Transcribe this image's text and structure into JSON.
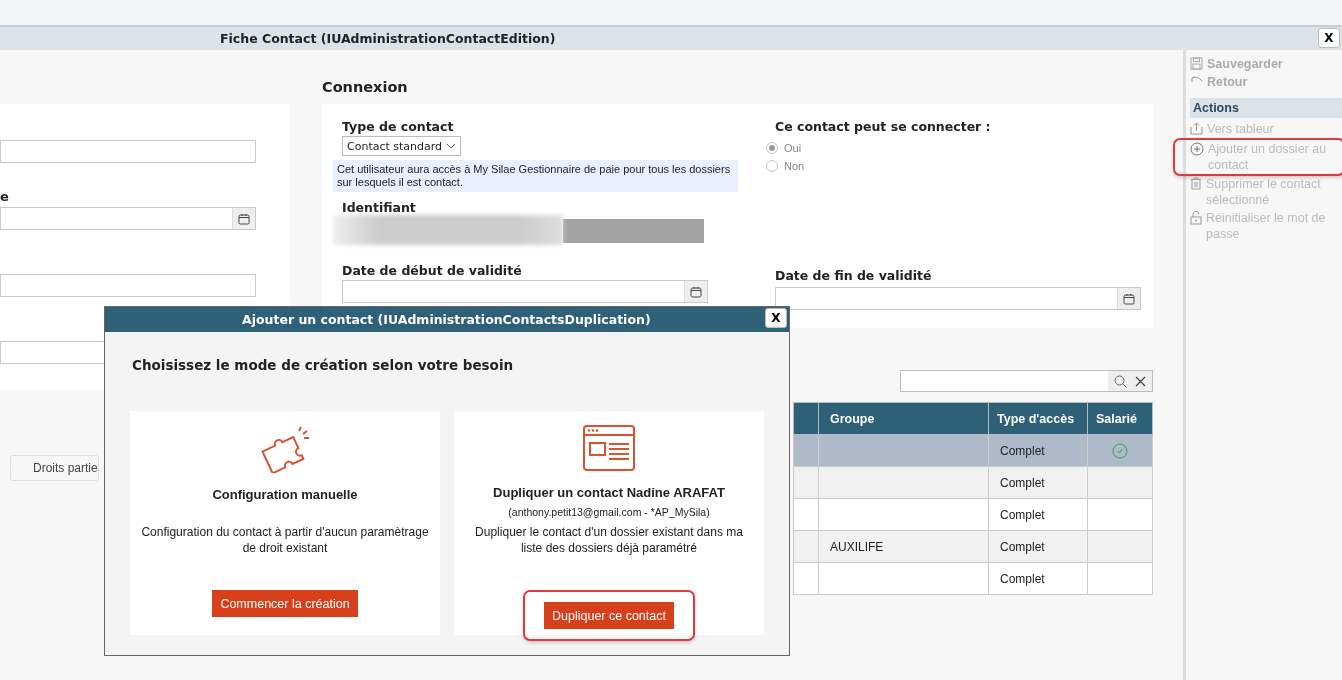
{
  "window": {
    "title": "Fiche Contact (IUAdministrationContactEdition)",
    "close": "X"
  },
  "left_form": {
    "fields": [
      {
        "kind": "text"
      },
      {
        "label": "e",
        "kind": "date"
      },
      {
        "kind": "text"
      },
      {
        "kind": "text"
      }
    ],
    "button": "Droits partie"
  },
  "connexion": {
    "title": "Connexion",
    "contact_type": {
      "label": "Type de contact",
      "value": "Contact standard"
    },
    "info": "Cet utilisateur aura accès à My Silae Gestionnaire de paie pour tous les dossiers sur lesquels il est contact.",
    "identifier": {
      "label": "Identifiant"
    },
    "can_connect": {
      "label": "Ce contact peut se connecter :",
      "options": [
        {
          "label": "Oui",
          "selected": true
        },
        {
          "label": "Non",
          "selected": false
        }
      ]
    },
    "start_date": {
      "label": "Date de début de validité"
    },
    "end_date": {
      "label": "Date de fin de validité"
    }
  },
  "table": {
    "columns": [
      "Groupe",
      "Type d'accès",
      "Salarié"
    ],
    "rows": [
      {
        "access": "Complet",
        "employee": true,
        "selected": true
      },
      {
        "access": "Complet",
        "employee": false,
        "selected": false
      },
      {
        "access": "Complet",
        "employee": false,
        "selected": false
      },
      {
        "group": "AUXILIFE",
        "access": "Complet",
        "employee": false,
        "selected": false
      },
      {
        "access": "Complet",
        "employee": false,
        "selected": false
      }
    ]
  },
  "sidebar": {
    "top_items": [
      {
        "label": "Sauvegarder",
        "disabled": true
      },
      {
        "label": "Retour",
        "disabled": true
      }
    ],
    "section": "Actions",
    "items": [
      {
        "label": "Vers tableur",
        "disabled": true,
        "highlighted": false
      },
      {
        "label": "Ajouter un dossier au contact",
        "disabled": true,
        "highlighted": true
      },
      {
        "label": "Supprimer le contact sélectionné",
        "disabled": true,
        "highlighted": false
      },
      {
        "label": "Réinitialiser le mot de passe",
        "disabled": true,
        "highlighted": false
      }
    ]
  },
  "dialog": {
    "title": "Ajouter un contact (IUAdministrationContactsDuplication)",
    "close": "X",
    "heading": "Choisissez le mode de création selon votre besoin",
    "options": [
      {
        "title": "Configuration manuelle",
        "description": "Configuration du contact à partir d'aucun paramètrage de droit existant",
        "button": "Commencer la création",
        "highlighted": false
      },
      {
        "title": "Dupliquer un contact Nadine ARAFAT",
        "subtitle": "(anthony.petit13@gmail.com - *AP_MySila)",
        "description": "Dupliquer le contact d'un dossier existant dans ma liste des dossiers déjà paramétré",
        "button": "Dupliquer ce contact",
        "highlighted": true
      }
    ]
  }
}
